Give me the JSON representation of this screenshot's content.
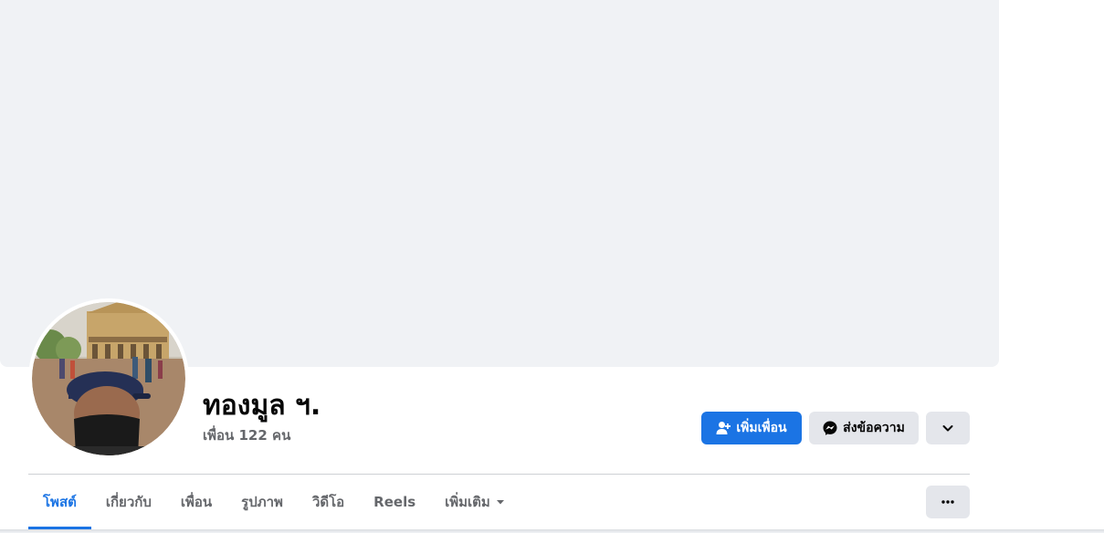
{
  "profile": {
    "name": "ทองมูล ฯ.",
    "friends_count": "เพื่อน 122 คน"
  },
  "actions": {
    "add_friend_label": "เพิ่มเพื่อน",
    "message_label": "ส่งข้อความ",
    "more_icon": "chevron-down-icon"
  },
  "tabs": [
    {
      "label": "โพสต์",
      "active": true
    },
    {
      "label": "เกี่ยวกับ",
      "active": false
    },
    {
      "label": "เพื่อน",
      "active": false
    },
    {
      "label": "รูปภาพ",
      "active": false
    },
    {
      "label": "วิดีโอ",
      "active": false
    },
    {
      "label": "Reels",
      "active": false
    },
    {
      "label": "เพิ่มเติม",
      "active": false
    }
  ],
  "colors": {
    "accent": "#1b74e4",
    "cover": "#f0f2f5",
    "secondary_button": "#e4e6eb",
    "muted_text": "#65676b"
  }
}
